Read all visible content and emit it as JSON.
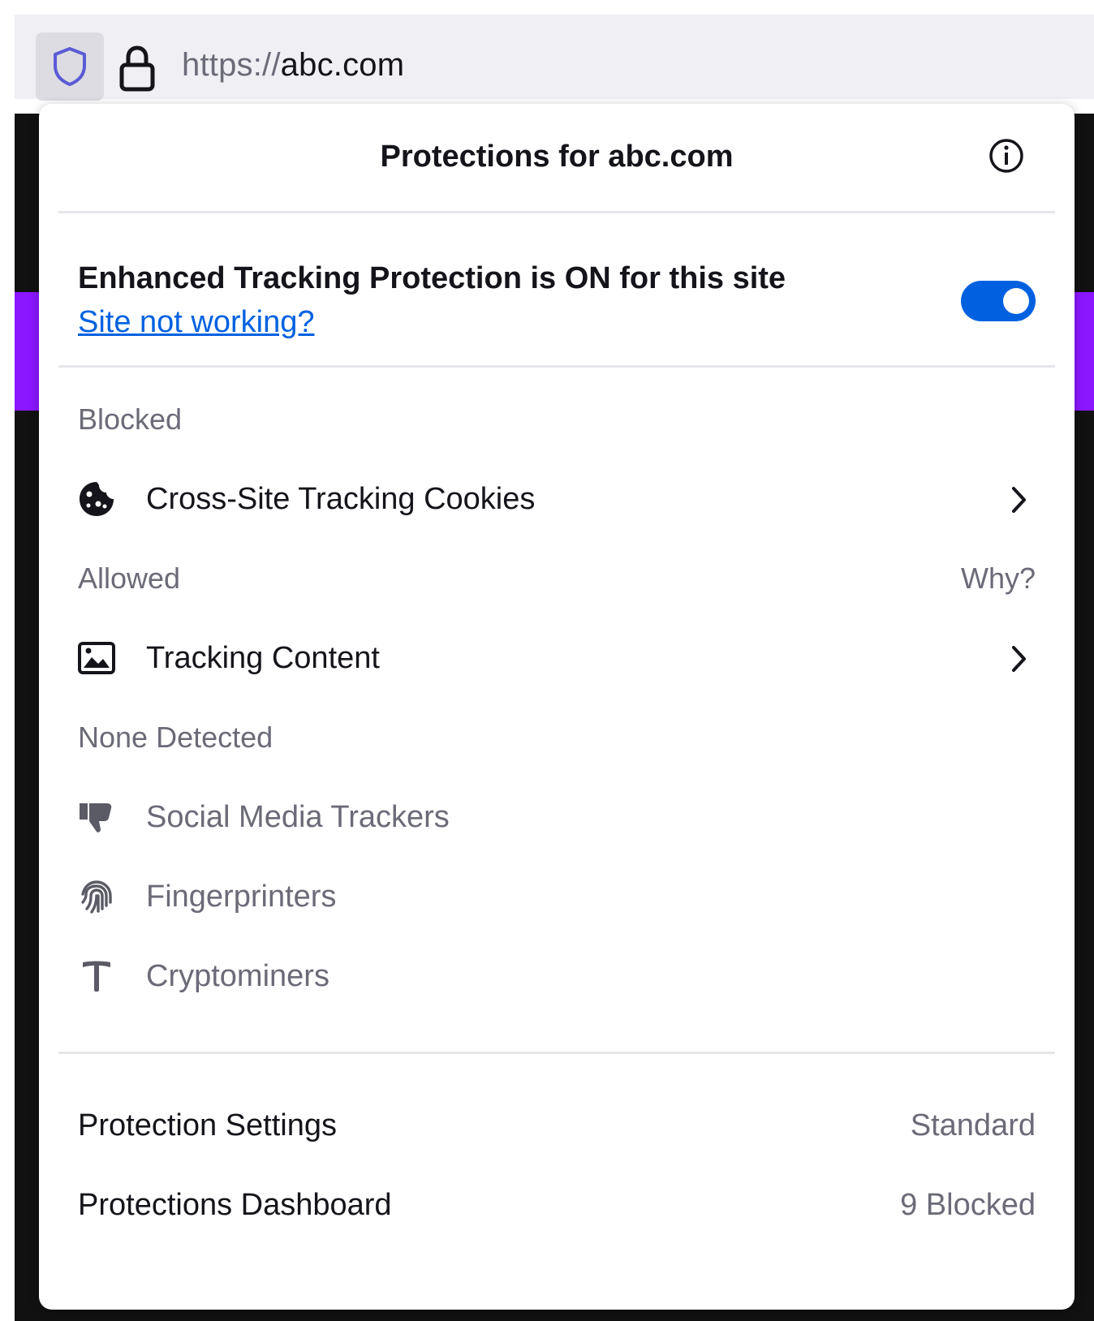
{
  "urlbar": {
    "scheme": "https://",
    "host": "abc.com",
    "shield_icon": "shield-icon",
    "lock_icon": "lock-icon"
  },
  "panel": {
    "title": "Protections for abc.com",
    "info_icon": "info-icon",
    "etp": {
      "status_text": "Enhanced Tracking Protection is ON for this site",
      "site_not_working_link": "Site not working?",
      "toggle_on": true
    },
    "blocked": {
      "label": "Blocked",
      "items": [
        {
          "label": "Cross-Site Tracking Cookies",
          "icon": "cookie-icon"
        }
      ]
    },
    "allowed": {
      "label": "Allowed",
      "why_link": "Why?",
      "items": [
        {
          "label": "Tracking Content",
          "icon": "image-icon"
        }
      ]
    },
    "none_detected": {
      "label": "None Detected",
      "items": [
        {
          "label": "Social Media Trackers",
          "icon": "thumbs-down-icon"
        },
        {
          "label": "Fingerprinters",
          "icon": "fingerprint-icon"
        },
        {
          "label": "Cryptominers",
          "icon": "pickaxe-icon"
        }
      ]
    },
    "footer": {
      "protection_settings": {
        "label": "Protection Settings",
        "value": "Standard"
      },
      "dashboard": {
        "label": "Protections Dashboard",
        "value": "9 Blocked"
      }
    }
  },
  "colors": {
    "accent": "#0061e0",
    "page_purple": "#8a17ff",
    "muted_text": "#6b6b78"
  }
}
